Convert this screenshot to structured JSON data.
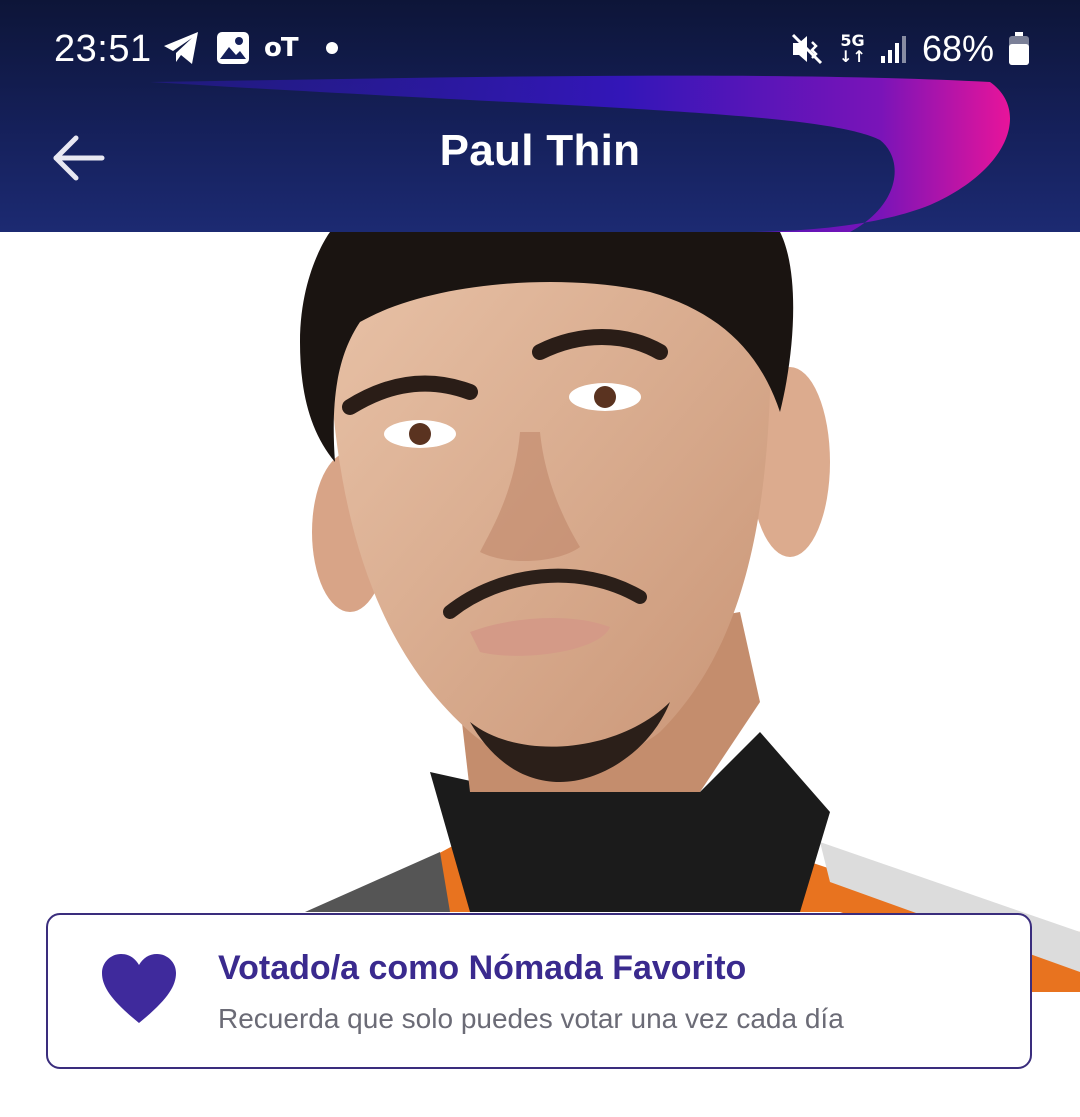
{
  "status_bar": {
    "time": "23:51",
    "left_icons": [
      "telegram-icon",
      "gallery-icon",
      "ot-app-icon",
      "notification-dot-icon"
    ],
    "ot_label": "oT",
    "network": "5G",
    "battery_percent": "68%",
    "right_icons": [
      "mute-vibrate-icon",
      "5g-data-icon",
      "signal-icon",
      "battery-icon"
    ]
  },
  "header": {
    "title": "Paul Thin",
    "back_icon": "arrow-left-icon"
  },
  "vote_card": {
    "icon": "heart-icon",
    "title": "Votado/a como Nómada Favorito",
    "subtitle": "Recuerda que solo puedes votar una vez cada día"
  },
  "colors": {
    "header_bg": "#15205a",
    "swoosh_start": "#3b1db0",
    "swoosh_end": "#e0138f",
    "accent": "#3a2a8e",
    "heart": "#3f2a9c"
  }
}
